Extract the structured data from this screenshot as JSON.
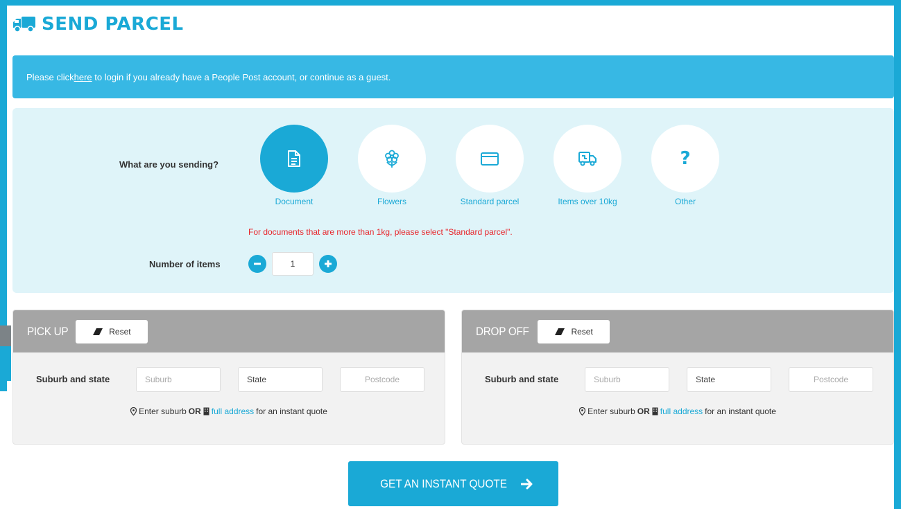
{
  "header": {
    "title": "SEND PARCEL",
    "icon": "truck-icon"
  },
  "login_banner": {
    "prefix": "Please click ",
    "link": "here",
    "suffix": " to login if you already have a People Post account, or continue as a guest."
  },
  "sending": {
    "question": "What are you sending?",
    "options": [
      {
        "label": "Document",
        "icon": "document-icon",
        "selected": true
      },
      {
        "label": "Flowers",
        "icon": "flower-icon",
        "selected": false
      },
      {
        "label": "Standard parcel",
        "icon": "parcel-box-icon",
        "selected": false
      },
      {
        "label": "Items over 10kg",
        "icon": "delivery-truck-icon",
        "selected": false
      },
      {
        "label": "Other",
        "icon": "question-icon",
        "selected": false
      }
    ],
    "warning": "For documents that are more than 1kg, please select \"Standard parcel\".",
    "items_label": "Number of items",
    "quantity": "1"
  },
  "pickup": {
    "title": "PICK UP",
    "reset_label": "Reset",
    "row_label": "Suburb and state",
    "suburb_placeholder": "Suburb",
    "state_value": "State",
    "postcode_placeholder": "Postcode",
    "hint_pre": "Enter suburb",
    "hint_or": "OR",
    "hint_link": "full address",
    "hint_post": "for an instant quote"
  },
  "dropoff": {
    "title": "DROP OFF",
    "reset_label": "Reset",
    "row_label": "Suburb and state",
    "suburb_placeholder": "Suburb",
    "state_value": "State",
    "postcode_placeholder": "Postcode",
    "hint_pre": "Enter suburb",
    "hint_or": "OR",
    "hint_link": "full address",
    "hint_post": "for an instant quote"
  },
  "quote_button": {
    "label": "GET AN INSTANT QUOTE"
  },
  "colors": {
    "accent": "#1aa9d6",
    "banner": "#37b8e4",
    "panel_bg": "#dff4f9",
    "section_head": "#a5a5a5",
    "warning": "#e8242a"
  }
}
